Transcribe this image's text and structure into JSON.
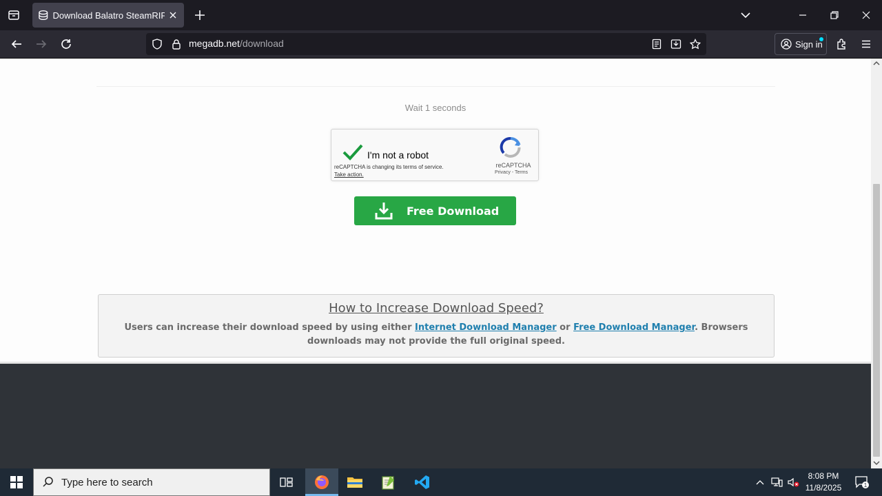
{
  "browser": {
    "tab_title": "Download Balatro SteamRIP com",
    "url_domain": "megadb.net",
    "url_path": "/download",
    "signin_label": "Sign in"
  },
  "page": {
    "wait_text": "Wait 1 seconds",
    "recaptcha": {
      "label": "I'm not a robot",
      "notice": "reCAPTCHA is changing its terms of service.",
      "action": "Take action.",
      "brand": "reCAPTCHA",
      "links": "Privacy - Terms"
    },
    "download_button": "Free Download",
    "info": {
      "heading": "How to Increase Download Speed?",
      "text_before": "Users can increase their download speed by using either ",
      "link1": "Internet Download Manager",
      "text_mid": " or ",
      "link2": "Free Download Manager",
      "text_after": ". Browsers downloads may not provide the full original speed."
    }
  },
  "taskbar": {
    "search_placeholder": "Type here to search",
    "time": "8:08 PM",
    "date": "11/8/2025",
    "notification_count": "1"
  },
  "colors": {
    "accent_green": "#28a745",
    "link_blue": "#1f7fae",
    "firefox_dark": "#1c1b22"
  }
}
